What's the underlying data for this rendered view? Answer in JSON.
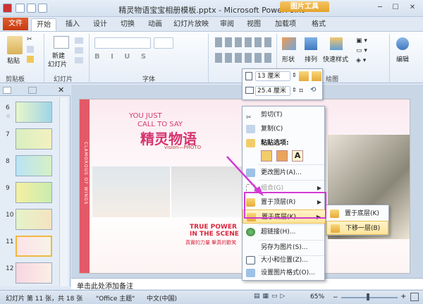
{
  "window": {
    "title": "精灵物语宝宝相册模板.pptx - Microsoft PowerPoint",
    "picture_tools": "图片工具"
  },
  "tabs": {
    "file": "文件",
    "items": [
      "开始",
      "插入",
      "设计",
      "切换",
      "动画",
      "幻灯片放映",
      "审阅",
      "视图",
      "加载项",
      "格式"
    ]
  },
  "ribbon": {
    "paste": "粘贴",
    "new_slide": "新建\n幻灯片",
    "new_slide_l1": "新建",
    "new_slide_l2": "幻灯片",
    "clipboard": "剪贴板",
    "slides": "幻灯片",
    "font": "字体",
    "drawing": "绘图",
    "shape": "形状",
    "arrange": "排列",
    "quick_style": "快速样式",
    "edit": "编辑"
  },
  "mini_toolbar": {
    "height": "13 厘米",
    "width": "25.4 厘米"
  },
  "slides_panel": {
    "items": [
      {
        "num": "6"
      },
      {
        "num": "7"
      },
      {
        "num": "8"
      },
      {
        "num": "9"
      },
      {
        "num": "10"
      },
      {
        "num": "11"
      },
      {
        "num": "12"
      }
    ],
    "star": "☆"
  },
  "slide": {
    "you_just": "YOU JUST",
    "call_to_say": "CALL TO SAY",
    "title": "精灵物语",
    "vision": "vision—PHOTO",
    "side_text": "CLAMOROUS OF WINGS",
    "true_power": "TRUE POWER",
    "in_the_scene": "IN THE SCENE",
    "cn_line": "真實的力量 擊真的歡笑"
  },
  "context_menu": {
    "cut": "剪切(T)",
    "copy": "复制(C)",
    "paste_options": "粘贴选项:",
    "change_picture": "更改图片(A)...",
    "group": "组合(G)",
    "bring_front": "置于顶层(R)",
    "send_back": "置于底层(K)",
    "hyperlink": "超链接(H)...",
    "save_as": "另存为图片(S)...",
    "size_pos": "大小和位置(Z)...",
    "format_pic": "设置图片格式(O)..."
  },
  "submenu": {
    "send_to_back": "置于底层(K)",
    "send_backward": "下移一层(B)"
  },
  "notes": {
    "placeholder": "单击此处添加备注"
  },
  "status": {
    "slide_info": "幻灯片 第 11 张，共 18 张",
    "theme": "\"Office 主题\"",
    "lang": "中文(中国)",
    "zoom": "65%"
  },
  "colors": {
    "accent": "#c63b12",
    "highlight": "#d33ad5"
  }
}
